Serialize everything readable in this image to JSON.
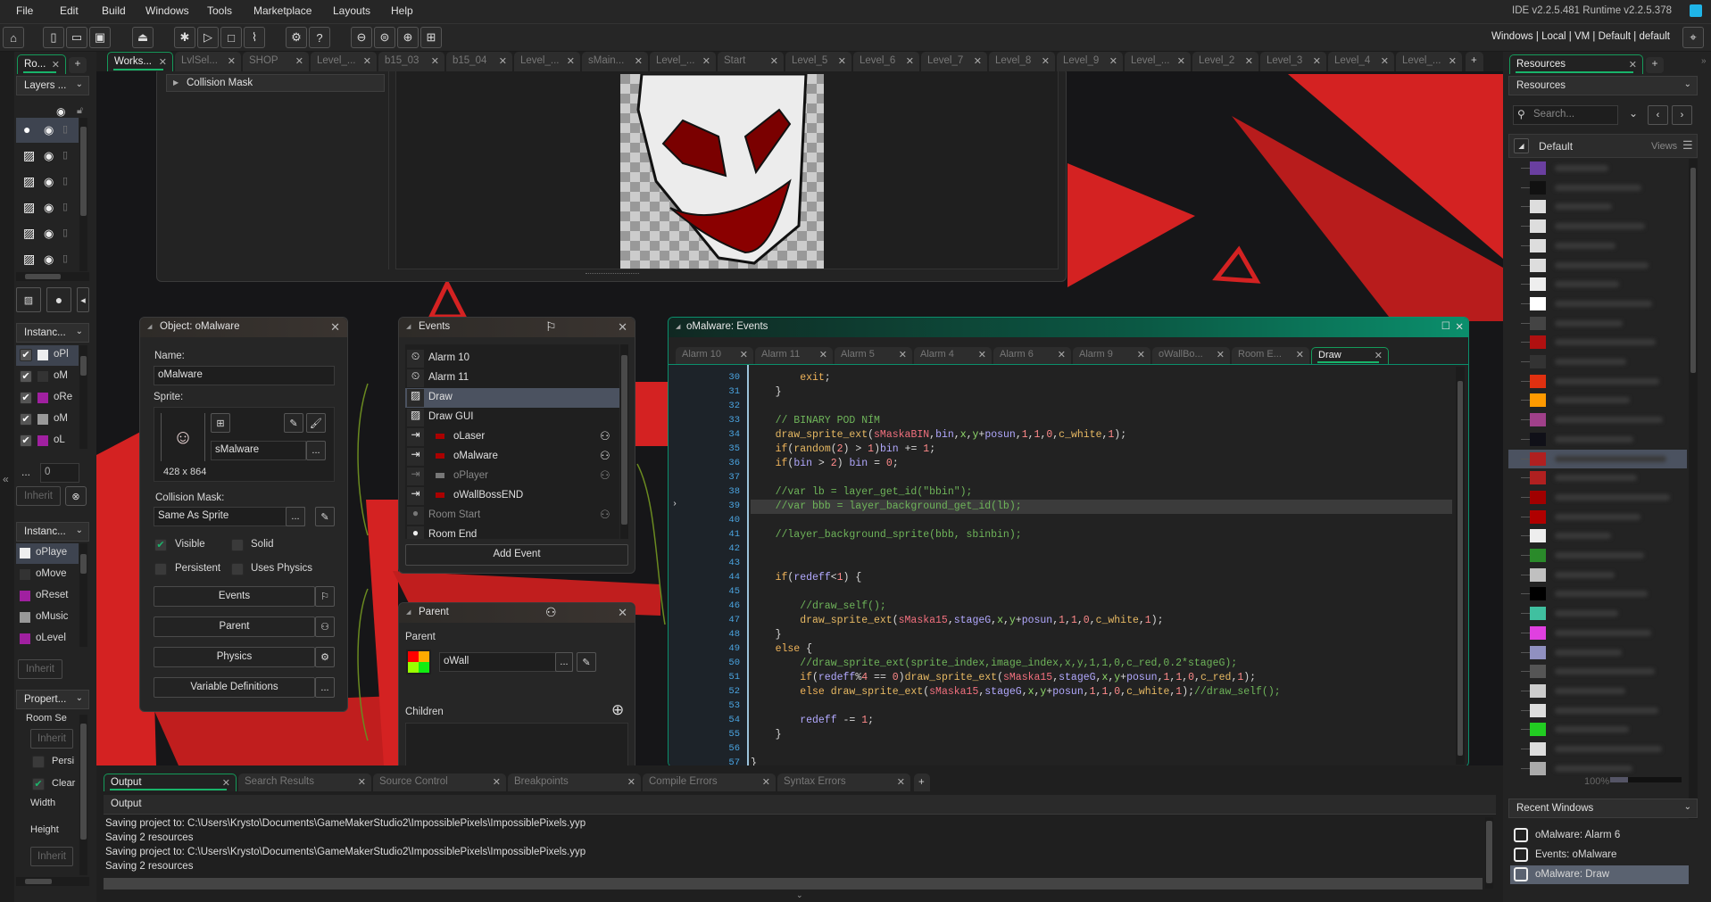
{
  "menu": [
    "File",
    "Edit",
    "Build",
    "Windows",
    "Tools",
    "Marketplace",
    "Layouts",
    "Help"
  ],
  "version": "IDE v2.2.5.481  Runtime v2.2.5.378",
  "targets": {
    "platform": "Windows",
    "device": "Local",
    "output": "VM",
    "config": "Default",
    "config2": "default",
    "sep": "|"
  },
  "toolbar_icons": [
    "home-icon",
    "new-project-icon",
    "open-project-icon",
    "save-project-icon",
    "create-executable-icon",
    "debug-icon",
    "run-icon",
    "stop-icon",
    "clean-icon",
    "preferences-icon",
    "help-icon",
    "zoom-out-icon",
    "zoom-reset-icon",
    "zoom-in-icon",
    "fit-icon"
  ],
  "tabs": [
    "Works...",
    "LvlSel...",
    "SHOP",
    "Level_...",
    "b15_03",
    "b15_04",
    "Level_...",
    "sMain...",
    "Level_...",
    "Start",
    "Level_5",
    "Level_6",
    "Level_7",
    "Level_8",
    "Level_9",
    "Level_...",
    "Level_2",
    "Level_3",
    "Level_4",
    "Level_..."
  ],
  "tab_add": "+",
  "left": {
    "tab": "Ro...",
    "tab_add": "+",
    "layers_dropdown": "Layers ...",
    "instances_dropdown": "Instanc...",
    "instances": [
      "oPl",
      "oM",
      "oRe",
      "oM",
      "oL"
    ],
    "dots": "...",
    "value": "0",
    "inherit": "Inherit",
    "instances2_dropdown": "Instanc...",
    "instances2": [
      "oPlaye",
      "oMove",
      "oReset",
      "oMusic",
      "oLevel"
    ],
    "properties_dropdown": "Propert...",
    "room_settings": "Room Se",
    "persistent": "Persi",
    "clear": "Clear",
    "width": "Width",
    "height": "Height",
    "collapse": "«"
  },
  "sprite_editor": {
    "collision_mask": "Collision Mask"
  },
  "object": {
    "title": "Object: oMalware",
    "name_label": "Name:",
    "name": "oMalware",
    "sprite_label": "Sprite:",
    "sprite": "sMalware",
    "sprite_size": "428 x 864",
    "mask_label": "Collision Mask:",
    "mask": "Same As Sprite",
    "visible": "Visible",
    "solid": "Solid",
    "persistent": "Persistent",
    "uses_physics": "Uses Physics",
    "visible_checked": true,
    "solid_checked": false,
    "persistent_checked": false,
    "uses_physics_checked": false,
    "buttons": [
      "Events",
      "Parent",
      "Physics",
      "Variable Definitions"
    ],
    "dots": "..."
  },
  "events": {
    "title": "Events",
    "items": [
      {
        "label": "Alarm 10",
        "icon": "alarm"
      },
      {
        "label": "Alarm 11",
        "icon": "alarm"
      },
      {
        "label": "Draw",
        "icon": "draw",
        "selected": true
      },
      {
        "label": "Draw GUI",
        "icon": "draw"
      },
      {
        "label": "oLaser",
        "icon": "collision",
        "inherited": true
      },
      {
        "label": "oMalware",
        "icon": "collision",
        "inherited": true
      },
      {
        "label": "oPlayer",
        "icon": "collision",
        "dim": true,
        "inherited": true
      },
      {
        "label": "oWallBossEND",
        "icon": "collision"
      },
      {
        "label": "Room Start",
        "icon": "room",
        "dim": true,
        "inherited": true
      },
      {
        "label": "Room End",
        "icon": "room"
      }
    ],
    "add": "Add Event"
  },
  "parent": {
    "title": "Parent",
    "label": "Parent",
    "value": "oWall",
    "children": "Children",
    "dots": "..."
  },
  "code": {
    "title": "oMalware: Events",
    "tabs": [
      "Alarm 10",
      "Alarm 11",
      "Alarm 5",
      "Alarm 4",
      "Alarm 6",
      "Alarm 9",
      "oWallBo...",
      "Room E...",
      "Draw"
    ],
    "active_tab": "Draw",
    "current_line": 39,
    "lines": [
      {
        "n": 30,
        "i": 2,
        "t": [
          [
            "k",
            "exit"
          ],
          [
            "p",
            ";"
          ]
        ]
      },
      {
        "n": 31,
        "i": 1,
        "t": [
          [
            "p",
            "}"
          ]
        ]
      },
      {
        "n": 32,
        "i": 0,
        "t": []
      },
      {
        "n": 33,
        "i": 1,
        "t": [
          [
            "c",
            "// BINARY POD NÍM"
          ]
        ]
      },
      {
        "n": 34,
        "i": 1,
        "t": [
          [
            "f",
            "draw_sprite_ext"
          ],
          [
            "p",
            "("
          ],
          [
            "r",
            "sMaskaBIN"
          ],
          [
            "p",
            ","
          ],
          [
            "v",
            "bin"
          ],
          [
            "p",
            ","
          ],
          [
            "b",
            "x"
          ],
          [
            "p",
            ","
          ],
          [
            "b",
            "y"
          ],
          [
            "p",
            "+"
          ],
          [
            "v",
            "posun"
          ],
          [
            "p",
            ","
          ],
          [
            "n",
            "1"
          ],
          [
            "p",
            ","
          ],
          [
            "n",
            "1"
          ],
          [
            "p",
            ","
          ],
          [
            "n",
            "0"
          ],
          [
            "p",
            ","
          ],
          [
            "f",
            "c_white"
          ],
          [
            "p",
            ","
          ],
          [
            "n",
            "1"
          ],
          [
            "p",
            ");"
          ]
        ]
      },
      {
        "n": 35,
        "i": 1,
        "t": [
          [
            "k",
            "if"
          ],
          [
            "p",
            "("
          ],
          [
            "f",
            "random"
          ],
          [
            "p",
            "("
          ],
          [
            "n",
            "2"
          ],
          [
            "p",
            ") > "
          ],
          [
            "n",
            "1"
          ],
          [
            "p",
            ")"
          ],
          [
            "v",
            "bin"
          ],
          [
            "p",
            " += "
          ],
          [
            "n",
            "1"
          ],
          [
            "p",
            ";"
          ]
        ]
      },
      {
        "n": 36,
        "i": 1,
        "t": [
          [
            "k",
            "if"
          ],
          [
            "p",
            "("
          ],
          [
            "v",
            "bin"
          ],
          [
            "p",
            " > "
          ],
          [
            "n",
            "2"
          ],
          [
            "p",
            ") "
          ],
          [
            "v",
            "bin"
          ],
          [
            "p",
            " = "
          ],
          [
            "n",
            "0"
          ],
          [
            "p",
            ";"
          ]
        ]
      },
      {
        "n": 37,
        "i": 0,
        "t": []
      },
      {
        "n": 38,
        "i": 1,
        "t": [
          [
            "c",
            "//var lb = layer_get_id(\"bbin\");"
          ]
        ]
      },
      {
        "n": 39,
        "i": 1,
        "t": [
          [
            "c",
            "//var bbb = layer_background_get_id(lb);"
          ]
        ]
      },
      {
        "n": 40,
        "i": 0,
        "t": []
      },
      {
        "n": 41,
        "i": 1,
        "t": [
          [
            "c",
            "//layer_background_sprite(bbb, sbinbin);"
          ]
        ]
      },
      {
        "n": 42,
        "i": 0,
        "t": []
      },
      {
        "n": 43,
        "i": 0,
        "t": []
      },
      {
        "n": 44,
        "i": 1,
        "t": [
          [
            "k",
            "if"
          ],
          [
            "p",
            "("
          ],
          [
            "v",
            "redeff"
          ],
          [
            "p",
            "<"
          ],
          [
            "n",
            "1"
          ],
          [
            "p",
            ") {"
          ]
        ]
      },
      {
        "n": 45,
        "i": 0,
        "t": []
      },
      {
        "n": 46,
        "i": 2,
        "t": [
          [
            "c",
            "//draw_self();"
          ]
        ]
      },
      {
        "n": 47,
        "i": 2,
        "t": [
          [
            "f",
            "draw_sprite_ext"
          ],
          [
            "p",
            "("
          ],
          [
            "r",
            "sMaska15"
          ],
          [
            "p",
            ","
          ],
          [
            "v",
            "stageG"
          ],
          [
            "p",
            ","
          ],
          [
            "b",
            "x"
          ],
          [
            "p",
            ","
          ],
          [
            "b",
            "y"
          ],
          [
            "p",
            "+"
          ],
          [
            "v",
            "posun"
          ],
          [
            "p",
            ","
          ],
          [
            "n",
            "1"
          ],
          [
            "p",
            ","
          ],
          [
            "n",
            "1"
          ],
          [
            "p",
            ","
          ],
          [
            "n",
            "0"
          ],
          [
            "p",
            ","
          ],
          [
            "f",
            "c_white"
          ],
          [
            "p",
            ","
          ],
          [
            "n",
            "1"
          ],
          [
            "p",
            ");"
          ]
        ]
      },
      {
        "n": 48,
        "i": 1,
        "t": [
          [
            "p",
            "}"
          ]
        ]
      },
      {
        "n": 49,
        "i": 1,
        "t": [
          [
            "k",
            "else"
          ],
          [
            "p",
            " {"
          ]
        ]
      },
      {
        "n": 50,
        "i": 2,
        "t": [
          [
            "c",
            "//draw_sprite_ext(sprite_index,image_index,x,y,1,1,0,c_red,0.2*stageG);"
          ]
        ]
      },
      {
        "n": 51,
        "i": 2,
        "t": [
          [
            "k",
            "if"
          ],
          [
            "p",
            "("
          ],
          [
            "v",
            "redeff"
          ],
          [
            "p",
            "%"
          ],
          [
            "n",
            "4"
          ],
          [
            "p",
            " == "
          ],
          [
            "n",
            "0"
          ],
          [
            "p",
            ")"
          ],
          [
            "f",
            "draw_sprite_ext"
          ],
          [
            "p",
            "("
          ],
          [
            "r",
            "sMaska15"
          ],
          [
            "p",
            ","
          ],
          [
            "v",
            "stageG"
          ],
          [
            "p",
            ","
          ],
          [
            "b",
            "x"
          ],
          [
            "p",
            ","
          ],
          [
            "b",
            "y"
          ],
          [
            "p",
            "+"
          ],
          [
            "v",
            "posun"
          ],
          [
            "p",
            ","
          ],
          [
            "n",
            "1"
          ],
          [
            "p",
            ","
          ],
          [
            "n",
            "1"
          ],
          [
            "p",
            ","
          ],
          [
            "n",
            "0"
          ],
          [
            "p",
            ","
          ],
          [
            "f",
            "c_red"
          ],
          [
            "p",
            ","
          ],
          [
            "n",
            "1"
          ],
          [
            "p",
            ");"
          ]
        ]
      },
      {
        "n": 52,
        "i": 2,
        "t": [
          [
            "k",
            "else"
          ],
          [
            "p",
            " "
          ],
          [
            "f",
            "draw_sprite_ext"
          ],
          [
            "p",
            "("
          ],
          [
            "r",
            "sMaska15"
          ],
          [
            "p",
            ","
          ],
          [
            "v",
            "stageG"
          ],
          [
            "p",
            ","
          ],
          [
            "b",
            "x"
          ],
          [
            "p",
            ","
          ],
          [
            "b",
            "y"
          ],
          [
            "p",
            "+"
          ],
          [
            "v",
            "posun"
          ],
          [
            "p",
            ","
          ],
          [
            "n",
            "1"
          ],
          [
            "p",
            ","
          ],
          [
            "n",
            "1"
          ],
          [
            "p",
            ","
          ],
          [
            "n",
            "0"
          ],
          [
            "p",
            ","
          ],
          [
            "f",
            "c_white"
          ],
          [
            "p",
            ","
          ],
          [
            "n",
            "1"
          ],
          [
            "p",
            ");"
          ],
          [
            "c",
            "//draw_self();"
          ]
        ]
      },
      {
        "n": 53,
        "i": 0,
        "t": []
      },
      {
        "n": 54,
        "i": 2,
        "t": [
          [
            "v",
            "redeff"
          ],
          [
            "p",
            " -= "
          ],
          [
            "n",
            "1"
          ],
          [
            "p",
            ";"
          ]
        ]
      },
      {
        "n": 55,
        "i": 1,
        "t": [
          [
            "p",
            "}"
          ]
        ]
      },
      {
        "n": 56,
        "i": 0,
        "t": []
      },
      {
        "n": 57,
        "i": 0,
        "t": [
          [
            "p",
            "}"
          ]
        ]
      }
    ]
  },
  "output": {
    "tabs": [
      "Output",
      "Search Results",
      "Source Control",
      "Breakpoints",
      "Compile Errors",
      "Syntax Errors"
    ],
    "tab_add": "+",
    "header": "Output",
    "lines": [
      "Saving project to: C:\\Users\\Krysto\\Documents\\GameMakerStudio2\\ImpossiblePixels\\ImpossiblePixels.yyp",
      "Saving 2 resources",
      "Saving project to: C:\\Users\\Krysto\\Documents\\GameMakerStudio2\\ImpossiblePixels\\ImpossiblePixels.yyp",
      "Saving 2 resources"
    ]
  },
  "resources": {
    "tab": "Resources",
    "tab_add": "+",
    "dropdown": "Resources",
    "search_placeholder": "Search...",
    "group": "Default",
    "views": "Views",
    "zoom": "100%",
    "tree_icons": [
      "#6a3fa0",
      "#111111",
      "#dddddd",
      "#dddddd",
      "#dddddd",
      "#dddddd",
      "#eeeeee",
      "#ffffff",
      "#444444",
      "#b01010",
      "#333333",
      "#e03010",
      "#ff9a00",
      "#a0408a",
      "#101018",
      "#b02020",
      "#b02020",
      "#a00000",
      "#b00000",
      "#eeeeee",
      "#2a8a2a",
      "#c0c0c0",
      "#000000",
      "#40c0a0",
      "#e040e0",
      "#9090c0",
      "#555555",
      "#cccccc",
      "#dddddd",
      "#22cc22",
      "#dddddd",
      "#aaaaaa"
    ],
    "selected_index": 15,
    "recent_label": "Recent Windows",
    "recent": [
      "oMalware: Alarm 6",
      "Events: oMalware",
      "oMalware: Draw"
    ],
    "recent_selected": 2
  },
  "colors": {
    "accent": "#19b46a",
    "brand_red": "#d42222",
    "selection": "#4b5260",
    "title_teal": "#0b8f6c"
  }
}
